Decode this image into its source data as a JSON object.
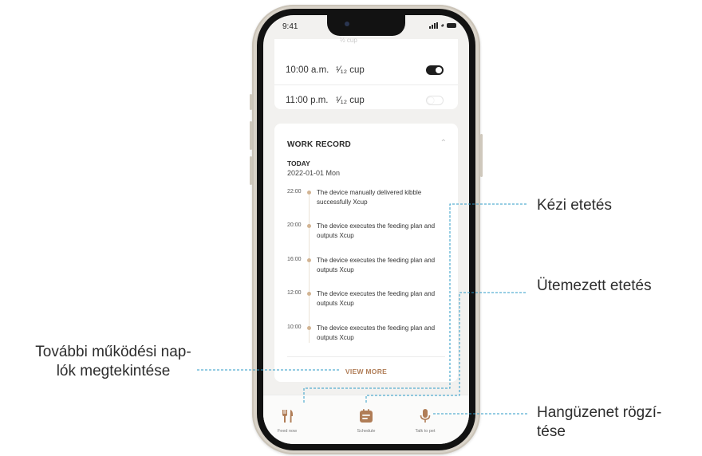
{
  "status_bar": {
    "time": "9:41"
  },
  "schedule": {
    "peek_amount": "½ cup",
    "rows": [
      {
        "time": "10:00 a.m.",
        "amount": "¹⁄₁₂ cup",
        "enabled": true
      },
      {
        "time": "11:00 p.m.",
        "amount": "¹⁄₁₂ cup",
        "enabled": false
      }
    ]
  },
  "work_record": {
    "title": "WORK RECORD",
    "day": "TODAY",
    "date": "2022-01-01 Mon",
    "entries": [
      {
        "time": "22:00",
        "text": "The device manually delivered kibble successfully Xcup"
      },
      {
        "time": "20:00",
        "text": "The device executes the feeding plan and outputs Xcup"
      },
      {
        "time": "16:00",
        "text": "The device executes the feeding plan and outputs Xcup"
      },
      {
        "time": "12:00",
        "text": "The device executes the feeding plan and outputs Xcup"
      },
      {
        "time": "10:00",
        "text": "The device executes the feeding plan and outputs Xcup"
      }
    ],
    "view_more": "VIEW MORE"
  },
  "tab_bar": {
    "tabs": [
      {
        "label": "Feed now",
        "icon": "fork-knife-icon"
      },
      {
        "label": "Schedule",
        "icon": "schedule-icon"
      },
      {
        "label": "Talk to pet",
        "icon": "microphone-icon"
      }
    ]
  },
  "callouts": {
    "manual_feeding": "Kézi etetés",
    "scheduled_feeding": "Ütemezett etetés",
    "more_logs_line1": "További működési nap-",
    "more_logs_line2": "lók megtekintése",
    "voice_record_line1": "Hangüzenet rögzí-",
    "voice_record_line2": "tése"
  },
  "colors": {
    "accent": "#b07d57",
    "timeline_dot": "#d2b493",
    "leader_line": "#2e9bc7",
    "toggle_on": "#1d1d1d"
  }
}
